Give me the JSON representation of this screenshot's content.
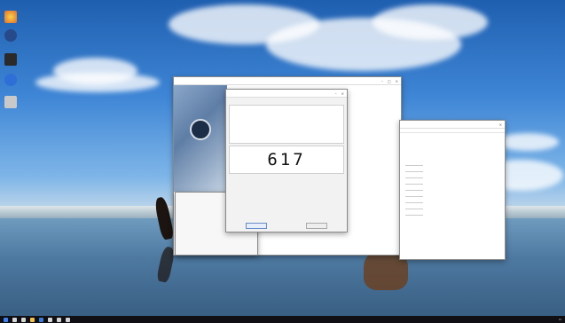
{
  "desktop": {
    "icons": [
      "recycle-bin",
      "help",
      "terminal",
      "edge",
      "settings"
    ]
  },
  "back_window": {
    "title": "",
    "tree_items": [
      "",
      "",
      "",
      "",
      "",
      "",
      "",
      "",
      ""
    ]
  },
  "right_window": {
    "title": "",
    "toolbar_items": [
      "",
      "",
      ""
    ]
  },
  "dialog": {
    "title": "",
    "fields": [
      {
        "label": "",
        "value": ""
      },
      {
        "label": "",
        "value": ""
      },
      {
        "label": "",
        "value": ""
      }
    ],
    "link_text": "",
    "section_label": "",
    "big_number": "617",
    "description_lines": [
      "",
      "",
      "",
      "",
      "",
      "",
      ""
    ],
    "buttons": [
      "",
      ""
    ]
  },
  "log_panel": {
    "rows": [
      "",
      "",
      "",
      "",
      "",
      "",
      "",
      "",
      "",
      ""
    ]
  },
  "taskbar": {
    "tray_time": ""
  }
}
